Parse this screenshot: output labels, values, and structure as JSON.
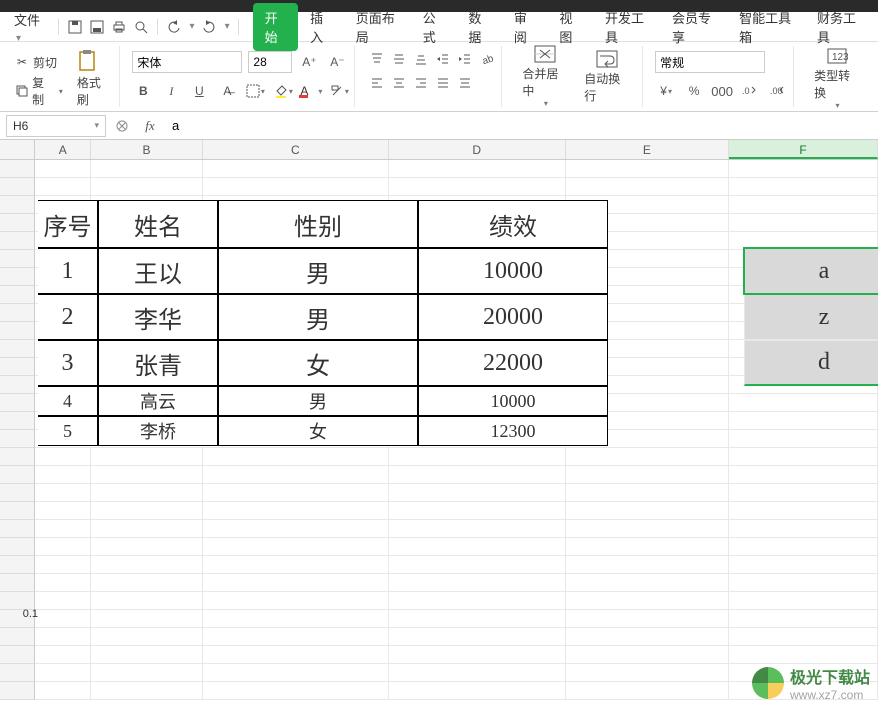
{
  "menu": {
    "file": "文件",
    "tabs": [
      "开始",
      "插入",
      "页面布局",
      "公式",
      "数据",
      "审阅",
      "视图",
      "开发工具",
      "会员专享",
      "智能工具箱",
      "财务工具"
    ],
    "active": 0
  },
  "ribbon": {
    "clipboard": {
      "cut": "剪切",
      "copy": "复制",
      "format_painter": "格式刷"
    },
    "font": {
      "name": "宋体",
      "size": "28"
    },
    "merge": "合并居中",
    "wrap": "自动换行",
    "number_format": "常规",
    "type_convert": "类型转换"
  },
  "formula": {
    "cell_ref": "H6",
    "value": "a"
  },
  "columns": [
    "A",
    "B",
    "C",
    "D",
    "E",
    "F"
  ],
  "selected_col": "F",
  "table": {
    "headers": [
      "序号",
      "姓名",
      "性别",
      "绩效"
    ],
    "rows": [
      [
        "1",
        "王以",
        "男",
        "10000"
      ],
      [
        "2",
        "李华",
        "男",
        "20000"
      ],
      [
        "3",
        "张青",
        "女",
        "22000"
      ],
      [
        "4",
        "高云",
        "男",
        "10000"
      ],
      [
        "5",
        "李桥",
        "女",
        "12300"
      ]
    ]
  },
  "side_values": [
    "a",
    "z",
    "d"
  ],
  "stray_value": "0.1",
  "watermark": {
    "name": "极光下载站",
    "url": "www.xz7.com"
  }
}
